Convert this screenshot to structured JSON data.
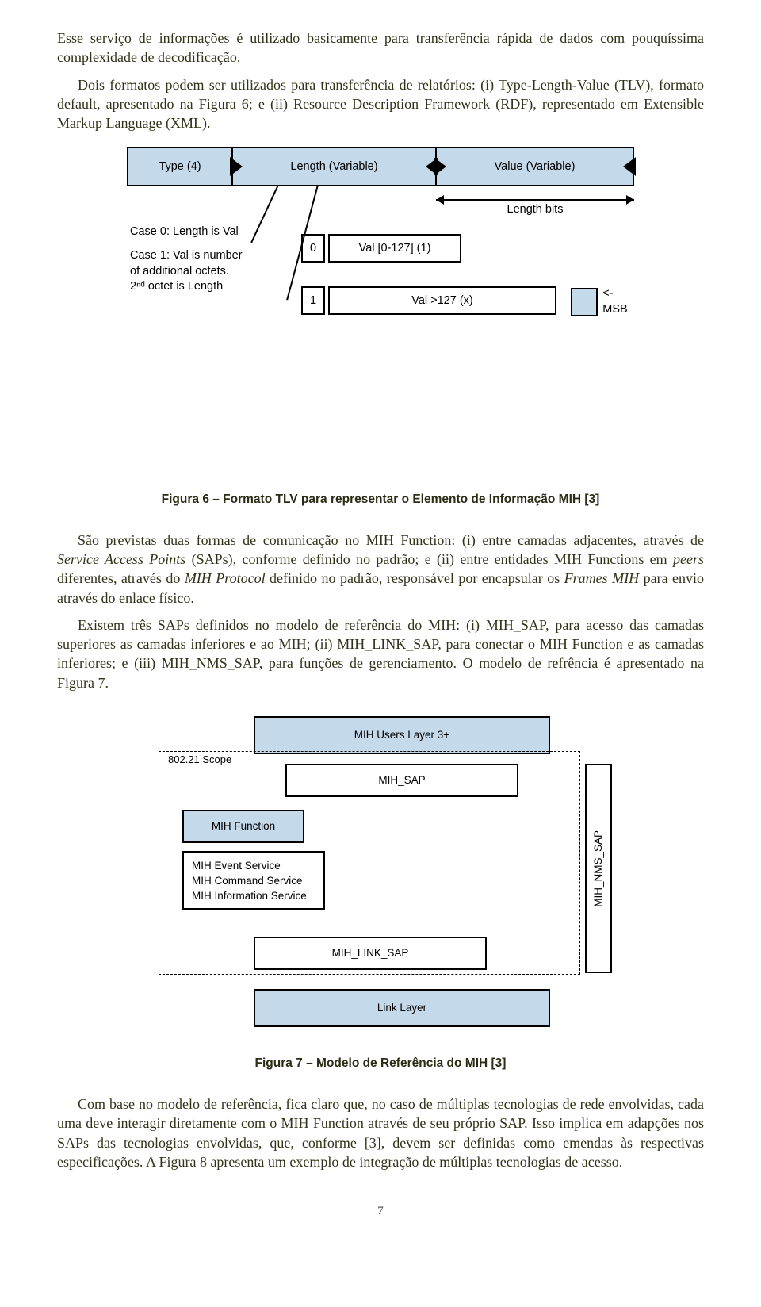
{
  "paragraphs": {
    "p1": "Esse serviço de informações é utilizado basicamente para transferência rápida de dados com pouquíssima complexidade de decodificação.",
    "p2": "Dois formatos podem ser utilizados para transferência de relatórios: (i) Type-Length-Value (TLV), formato default, apresentado na Figura 6; e (ii) Resource Description Framework (RDF), representado em Extensible Markup Language (XML).",
    "p3_a": "São previstas duas formas de comunicação no MIH Function: (i) entre camadas adjacentes, através de ",
    "p3_sap": "Service Access Points",
    "p3_b": " (SAPs), conforme definido no padrão; e (ii) entre entidades MIH Functions em ",
    "p3_peers": "peers",
    "p3_c": " diferentes, através do ",
    "p3_proto": "MIH Protocol",
    "p3_d": " definido no padrão, responsável por encapsular os ",
    "p3_frames": "Frames MIH",
    "p3_e": " para envio através do enlace físico.",
    "p4": "Existem três SAPs definidos no modelo de referência do MIH: (i) MIH_SAP, para acesso das camadas superiores as camadas inferiores e ao MIH; (ii) MIH_LINK_SAP, para conectar o MIH Function e as camadas inferiores; e (iii) MIH_NMS_SAP, para funções de gerenciamento. O modelo de refrência é apresentado na Figura 7.",
    "p5": "Com base no modelo de referência, fica claro que, no caso de múltiplas tecnologias de rede envolvidas, cada uma deve interagir diretamente com o MIH Function através de seu próprio SAP. Isso implica em adapções nos SAPs das tecnologias envolvidas, que, conforme [3], devem ser definidas como emendas às respectivas especificações. A Figura 8 apresenta um exemplo de integração de múltiplas tecnologias de acesso."
  },
  "fig6": {
    "caption": "Figura 6 – Formato TLV para representar o Elemento de Informação MIH [3]",
    "header": {
      "type": "Type (4)",
      "length": "Length (Variable)",
      "value": "Value (Variable)"
    },
    "length_bits": "Length bits",
    "case0": "Case 0: Length is Val",
    "case1a": "Case 1: Val is number",
    "case1b": "of additional octets.",
    "case1c": "2ⁿᵈ octet is Length",
    "row2_bit": "0",
    "row2_box": "Val [0-127] (1)",
    "row3_bit": "1",
    "row3_box": "Val >127 (x)",
    "msb": "<-MSB"
  },
  "fig7": {
    "caption": "Figura 7 – Modelo de Referência do MIH [3]",
    "scope": "802.21 Scope",
    "layer3": "MIH Users Layer 3+",
    "mihsap": "MIH_SAP",
    "mihfn": "MIH Function",
    "svc1": "MIH Event Service",
    "svc2": "MIH Command Service",
    "svc3": "MIH Information Service",
    "mihlink": "MIH_LINK_SAP",
    "nms": "MIH_NMS_SAP",
    "linklayer": "Link Layer"
  },
  "page_number": "7"
}
